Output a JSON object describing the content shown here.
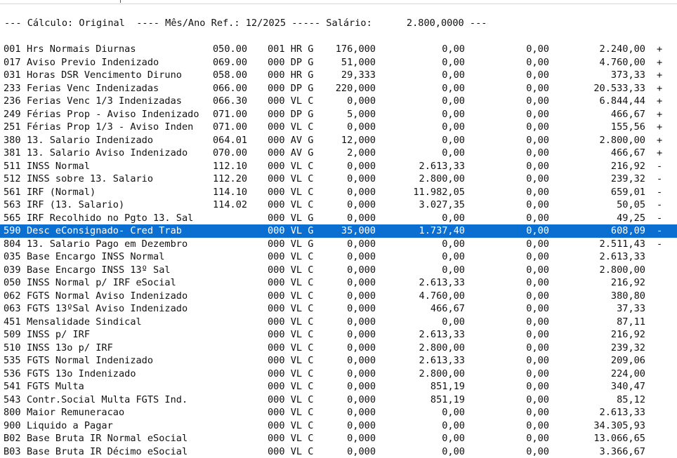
{
  "header": {
    "text": "--- Cálculo: Original  ---- Mês/Ano Ref.: 12/2025 ----- Salário:      2.800,0000 ---"
  },
  "rows": [
    {
      "code": "001",
      "desc": "Hrs Normais Diurnas",
      "ref": "050.00",
      "flag": "001 HR G",
      "qty": "176,000",
      "v1": "0,00",
      "v2": "0,00",
      "v3": "2.240,00",
      "sign": "+"
    },
    {
      "code": "017",
      "desc": "Aviso Previo Indenizado",
      "ref": "069.00",
      "flag": "000 DP G",
      "qty": "51,000",
      "v1": "0,00",
      "v2": "0,00",
      "v3": "4.760,00",
      "sign": "+"
    },
    {
      "code": "031",
      "desc": "Horas DSR Vencimento Diruno",
      "ref": "058.00",
      "flag": "000 HR G",
      "qty": "29,333",
      "v1": "0,00",
      "v2": "0,00",
      "v3": "373,33",
      "sign": "+"
    },
    {
      "code": "233",
      "desc": "Ferias Venc Indenizadas",
      "ref": "066.00",
      "flag": "000 DP G",
      "qty": "220,000",
      "v1": "0,00",
      "v2": "0,00",
      "v3": "20.533,33",
      "sign": "+"
    },
    {
      "code": "236",
      "desc": "Ferias Venc 1/3 Indenizadas",
      "ref": "066.30",
      "flag": "000 VL C",
      "qty": "0,000",
      "v1": "0,00",
      "v2": "0,00",
      "v3": "6.844,44",
      "sign": "+"
    },
    {
      "code": "249",
      "desc": "Férias Prop - Aviso Indenizado",
      "ref": "071.00",
      "flag": "000 DP G",
      "qty": "5,000",
      "v1": "0,00",
      "v2": "0,00",
      "v3": "466,67",
      "sign": "+"
    },
    {
      "code": "251",
      "desc": "Férias Prop 1/3 - Aviso Inden",
      "ref": "071.00",
      "flag": "000 VL C",
      "qty": "0,000",
      "v1": "0,00",
      "v2": "0,00",
      "v3": "155,56",
      "sign": "+"
    },
    {
      "code": "380",
      "desc": "13. Salario Indenizado",
      "ref": "064.01",
      "flag": "000 AV G",
      "qty": "12,000",
      "v1": "0,00",
      "v2": "0,00",
      "v3": "2.800,00",
      "sign": "+"
    },
    {
      "code": "381",
      "desc": "13. Salario Aviso Indenizado",
      "ref": "070.00",
      "flag": "000 AV G",
      "qty": "2,000",
      "v1": "0,00",
      "v2": "0,00",
      "v3": "466,67",
      "sign": "+"
    },
    {
      "code": "511",
      "desc": "INSS Normal",
      "ref": "112.10",
      "flag": "000 VL C",
      "qty": "0,000",
      "v1": "2.613,33",
      "v2": "0,00",
      "v3": "216,92",
      "sign": "-"
    },
    {
      "code": "512",
      "desc": "INSS sobre 13. Salario",
      "ref": "112.20",
      "flag": "000 VL C",
      "qty": "0,000",
      "v1": "2.800,00",
      "v2": "0,00",
      "v3": "239,32",
      "sign": "-"
    },
    {
      "code": "561",
      "desc": "IRF (Normal)",
      "ref": "114.10",
      "flag": "000 VL C",
      "qty": "0,000",
      "v1": "11.982,05",
      "v2": "0,00",
      "v3": "659,01",
      "sign": "-"
    },
    {
      "code": "563",
      "desc": "IRF (13. Salario)",
      "ref": "114.02",
      "flag": "000 VL C",
      "qty": "0,000",
      "v1": "3.027,35",
      "v2": "0,00",
      "v3": "50,05",
      "sign": "-"
    },
    {
      "code": "565",
      "desc": "IRF Recolhido no Pgto 13. Sal",
      "ref": "",
      "flag": "000 VL G",
      "qty": "0,000",
      "v1": "0,00",
      "v2": "0,00",
      "v3": "49,25",
      "sign": "-"
    },
    {
      "code": "590",
      "desc": "Desc eConsignado- Cred Trab",
      "ref": "",
      "flag": "000 VL G",
      "qty": "35,000",
      "v1": "1.737,40",
      "v2": "0,00",
      "v3": "608,09",
      "sign": "-",
      "selected": true
    },
    {
      "code": "804",
      "desc": "13. Salario Pago em Dezembro",
      "ref": "",
      "flag": "000 VL G",
      "qty": "0,000",
      "v1": "0,00",
      "v2": "0,00",
      "v3": "2.511,43",
      "sign": "-"
    },
    {
      "code": "035",
      "desc": "Base Encargo INSS Normal",
      "ref": "",
      "flag": "000 VL C",
      "qty": "0,000",
      "v1": "0,00",
      "v2": "0,00",
      "v3": "2.613,33",
      "sign": ""
    },
    {
      "code": "039",
      "desc": "Base Encargo INSS 13º Sal",
      "ref": "",
      "flag": "000 VL C",
      "qty": "0,000",
      "v1": "0,00",
      "v2": "0,00",
      "v3": "2.800,00",
      "sign": ""
    },
    {
      "code": "050",
      "desc": "INSS Normal p/ IRF eSocial",
      "ref": "",
      "flag": "000 VL C",
      "qty": "0,000",
      "v1": "2.613,33",
      "v2": "0,00",
      "v3": "216,92",
      "sign": ""
    },
    {
      "code": "062",
      "desc": "FGTS Normal Aviso Indenizado",
      "ref": "",
      "flag": "000 VL C",
      "qty": "0,000",
      "v1": "4.760,00",
      "v2": "0,00",
      "v3": "380,80",
      "sign": ""
    },
    {
      "code": "063",
      "desc": "FGTS 13ºSal Aviso Indenizado",
      "ref": "",
      "flag": "000 VL C",
      "qty": "0,000",
      "v1": "466,67",
      "v2": "0,00",
      "v3": "37,33",
      "sign": ""
    },
    {
      "code": "451",
      "desc": "Mensalidade Sindical",
      "ref": "",
      "flag": "000 VL C",
      "qty": "0,000",
      "v1": "0,00",
      "v2": "0,00",
      "v3": "87,11",
      "sign": ""
    },
    {
      "code": "509",
      "desc": "INSS p/ IRF",
      "ref": "",
      "flag": "000 VL C",
      "qty": "0,000",
      "v1": "2.613,33",
      "v2": "0,00",
      "v3": "216,92",
      "sign": ""
    },
    {
      "code": "510",
      "desc": "INSS 13o p/ IRF",
      "ref": "",
      "flag": "000 VL C",
      "qty": "0,000",
      "v1": "2.800,00",
      "v2": "0,00",
      "v3": "239,32",
      "sign": ""
    },
    {
      "code": "535",
      "desc": "FGTS Normal Indenizado",
      "ref": "",
      "flag": "000 VL C",
      "qty": "0,000",
      "v1": "2.613,33",
      "v2": "0,00",
      "v3": "209,06",
      "sign": ""
    },
    {
      "code": "536",
      "desc": "FGTS 13o Indenizado",
      "ref": "",
      "flag": "000 VL C",
      "qty": "0,000",
      "v1": "2.800,00",
      "v2": "0,00",
      "v3": "224,00",
      "sign": ""
    },
    {
      "code": "541",
      "desc": "FGTS Multa",
      "ref": "",
      "flag": "000 VL C",
      "qty": "0,000",
      "v1": "851,19",
      "v2": "0,00",
      "v3": "340,47",
      "sign": ""
    },
    {
      "code": "543",
      "desc": "Contr.Social Multa FGTS Ind.",
      "ref": "",
      "flag": "000 VL C",
      "qty": "0,000",
      "v1": "851,19",
      "v2": "0,00",
      "v3": "85,12",
      "sign": ""
    },
    {
      "code": "800",
      "desc": "Maior Remuneracao",
      "ref": "",
      "flag": "000 VL C",
      "qty": "0,000",
      "v1": "0,00",
      "v2": "0,00",
      "v3": "2.613,33",
      "sign": ""
    },
    {
      "code": "900",
      "desc": "Liquido a Pagar",
      "ref": "",
      "flag": "000 VL C",
      "qty": "0,000",
      "v1": "0,00",
      "v2": "0,00",
      "v3": "34.305,93",
      "sign": ""
    },
    {
      "code": "B02",
      "desc": "Base Bruta IR Normal eSocial",
      "ref": "",
      "flag": "000 VL C",
      "qty": "0,000",
      "v1": "0,00",
      "v2": "0,00",
      "v3": "13.066,65",
      "sign": ""
    },
    {
      "code": "B03",
      "desc": "Base Bruta IR Décimo eSocial",
      "ref": "",
      "flag": "000 VL C",
      "qty": "0,000",
      "v1": "0,00",
      "v2": "0,00",
      "v3": "3.366,67",
      "sign": ""
    }
  ]
}
